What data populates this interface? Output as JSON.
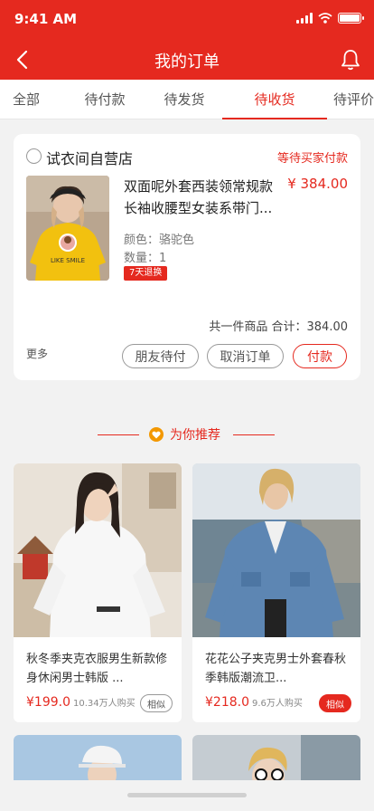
{
  "status_bar": {
    "time": "9:41 AM"
  },
  "nav": {
    "title": "我的订单",
    "back_icon": "chevron-left-icon",
    "bell_icon": "bell-icon"
  },
  "tabs": [
    {
      "label": "全部",
      "active": false
    },
    {
      "label": "待付款",
      "active": false
    },
    {
      "label": "待发货",
      "active": false
    },
    {
      "label": "待收货",
      "active": true
    },
    {
      "label": "待评价",
      "active": false
    }
  ],
  "order": {
    "shop_name": "试衣间自营店",
    "status": "等待买家付款",
    "product_title": "双面呢外套西装领常规款长袖收腰型女装系带门...",
    "price": "¥ 384.00",
    "color": "颜色：骆驼色",
    "quantity": "数量：1",
    "return_badge": "7天退换",
    "summary": "共一件商品  合计：384.00",
    "more": "更多",
    "buttons": {
      "friend_pay": "朋友待付",
      "cancel": "取消订单",
      "pay": "付款"
    },
    "image_print": "LIKE SMILE"
  },
  "recommend": {
    "title": "为你推荐",
    "items": [
      {
        "name": "秋冬季夹克衣服男生新款修身休闲男士韩版 ...",
        "price": "¥199.0",
        "sold": "10.34万人购买",
        "similar": "相似",
        "similar_filled": false
      },
      {
        "name": "花花公子夹克男士外套春秋季韩版潮流卫...",
        "price": "¥218.0",
        "sold": "9.6万人购买",
        "similar": "相似",
        "similar_filled": true
      }
    ]
  },
  "colors": {
    "accent": "#e5291f",
    "background": "#f2f2f2",
    "heart": "#f39800"
  }
}
